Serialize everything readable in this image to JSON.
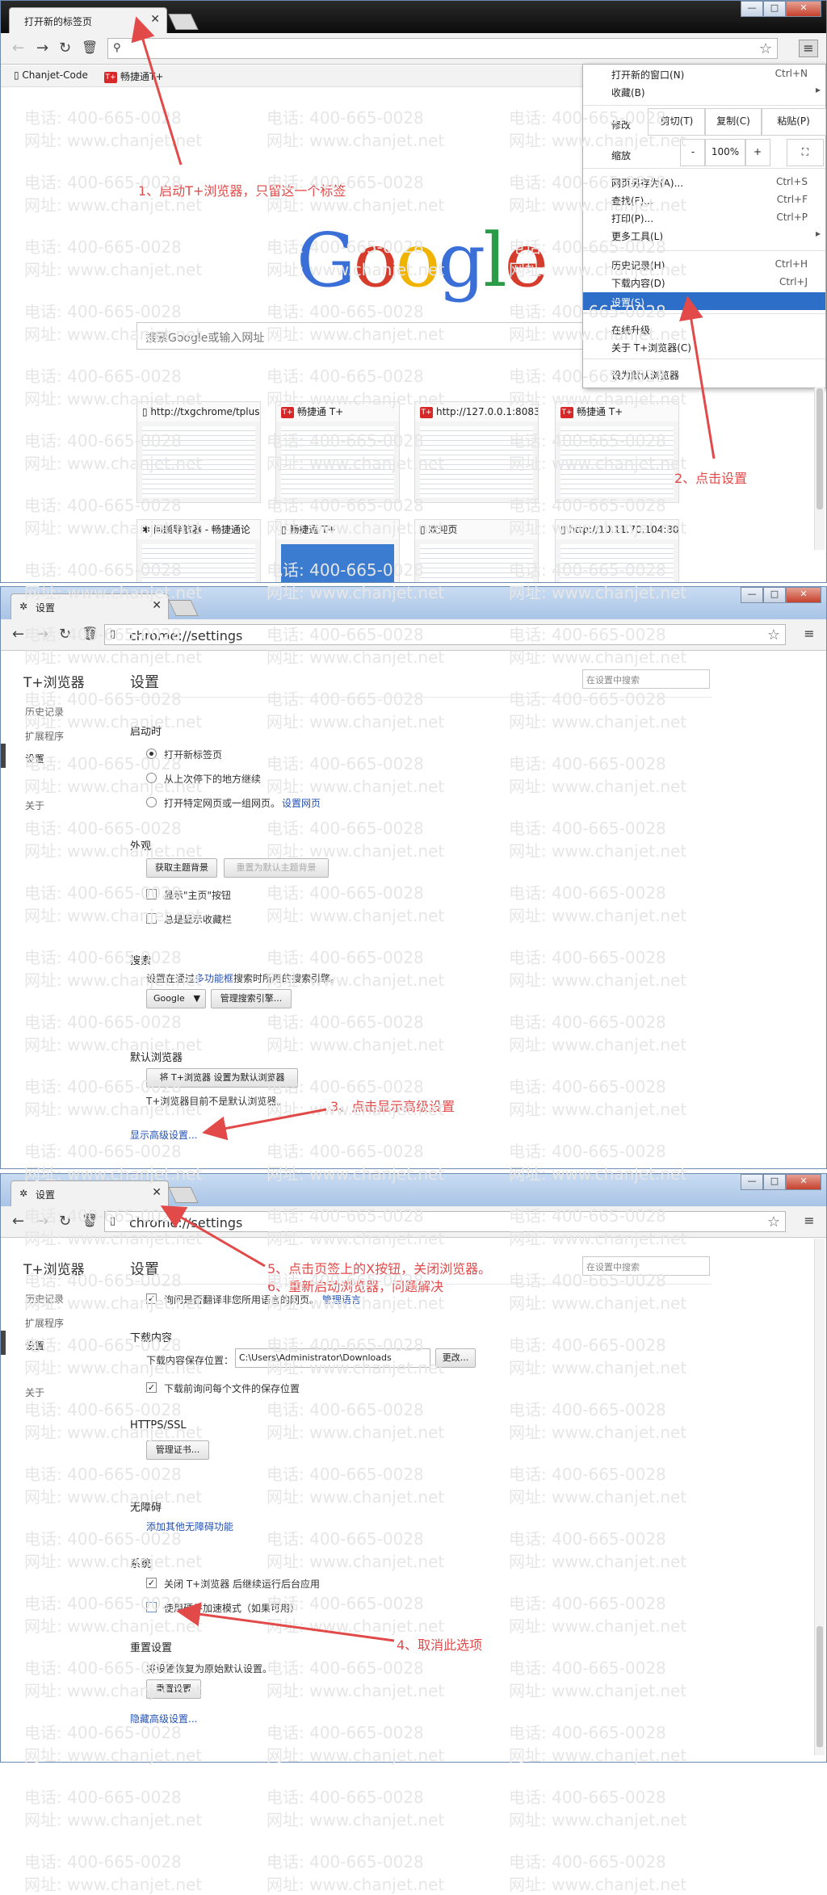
{
  "watermark": {
    "phone": "电话: 400-665-0028",
    "site": "网址: www.chanjet.net"
  },
  "panel1": {
    "tab_title": "打开新的标签页",
    "bookmarks": [
      "Chanjet-Code",
      "畅捷通T+"
    ],
    "google_letters": [
      "G",
      "o",
      "o",
      "g",
      "l",
      "e"
    ],
    "search_placeholder": "搜索Google或输入网址",
    "thumbnails": [
      {
        "title": "http://txgchrome/tplus"
      },
      {
        "title": "畅捷通 T+"
      },
      {
        "title": "http://127.0.0.1:8083/t"
      },
      {
        "title": "畅捷通 T+"
      },
      {
        "title": "问题导航器 - 畅捷通论"
      },
      {
        "title": "畅捷通 T+"
      },
      {
        "title": "欢迎页"
      },
      {
        "title": "http://10.11.70.104:80"
      }
    ],
    "menu": {
      "new_window": "打开新的窗口(N)",
      "new_window_sc": "Ctrl+N",
      "bookmarks": "收藏(B)",
      "edit": "修改",
      "cut": "剪切(T)",
      "copy": "复制(C)",
      "paste": "粘贴(P)",
      "zoom": "缩放",
      "zoom_minus": "-",
      "zoom_value": "100%",
      "zoom_plus": "+",
      "save_as": "网页另存为(A)...",
      "save_as_sc": "Ctrl+S",
      "find": "查找(F)...",
      "find_sc": "Ctrl+F",
      "print": "打印(P)...",
      "print_sc": "Ctrl+P",
      "more_tools": "更多工具(L)",
      "history": "历史记录(H)",
      "history_sc": "Ctrl+H",
      "downloads": "下载内容(D)",
      "downloads_sc": "Ctrl+J",
      "settings": "设置(S)",
      "upgrade": "在线升级",
      "about": "关于 T+浏览器(C)",
      "default": "设为默认浏览器"
    },
    "annotations": {
      "a1": "1、启动T+浏览器，只留这一个标签",
      "a2": "2、点击设置"
    }
  },
  "panel2": {
    "tab_title": "设置",
    "url": "chrome://settings",
    "brand": "T+浏览器",
    "side_items": [
      "历史记录",
      "扩展程序",
      "设置",
      "关于"
    ],
    "page_title": "设置",
    "search_placeholder": "在设置中搜索",
    "startup": {
      "head": "启动时",
      "opt1": "打开新标签页",
      "opt2": "从上次停下的地方继续",
      "opt3": "打开特定网页或一组网页。",
      "opt3_link": "设置网页"
    },
    "appearance": {
      "head": "外观",
      "btn_theme": "获取主题背景",
      "btn_reset": "重置为默认主题背景",
      "chk1": "显示\"主页\"按钮",
      "chk2": "总是显示收藏栏"
    },
    "search": {
      "head": "搜索",
      "desc_pre": "设置在通过",
      "desc_link": "多功能框",
      "desc_post": "搜索时所用的搜索引擎。",
      "engine": "Google",
      "manage": "管理搜索引擎..."
    },
    "default_browser": {
      "head": "默认浏览器",
      "btn": "将 T+浏览器 设置为默认浏览器",
      "status": "T+浏览器目前不是默认浏览器。"
    },
    "advanced_link": "显示高级设置...",
    "annotation": "3、点击显示高级设置"
  },
  "panel3": {
    "tab_title": "设置",
    "url": "chrome://settings",
    "brand": "T+浏览器",
    "side_items": [
      "历史记录",
      "扩展程序",
      "设置",
      "关于"
    ],
    "page_title": "设置",
    "search_placeholder": "在设置中搜索",
    "translate": {
      "text": "询问是否翻译非您所用语言的网页。",
      "link": "管理语言"
    },
    "downloads": {
      "head": "下载内容",
      "label": "下载内容保存位置：",
      "path": "C:\\Users\\Administrator\\Downloads",
      "change": "更改...",
      "ask": "下载前询问每个文件的保存位置"
    },
    "https": {
      "head": "HTTPS/SSL",
      "btn": "管理证书..."
    },
    "a11y": {
      "head": "无障碍",
      "link": "添加其他无障碍功能"
    },
    "system": {
      "head": "系统",
      "chk1": "关闭 T+浏览器 后继续运行后台应用",
      "chk2": "使用硬件加速模式（如果可用）"
    },
    "reset": {
      "head": "重置设置",
      "desc": "将设置恢复为原始默认设置。",
      "btn": "重置设置"
    },
    "hide_link": "隐藏高级设置...",
    "annotations": {
      "a5": "5、点击页签上的X按钮，关闭浏览器。",
      "a6": "6、重新启动浏览器，问题解决",
      "a4": "4、取消此选项"
    }
  },
  "colors": {
    "annotation": "#e24a4a",
    "highlight": "#2d6ec8",
    "link": "#2352b5"
  }
}
